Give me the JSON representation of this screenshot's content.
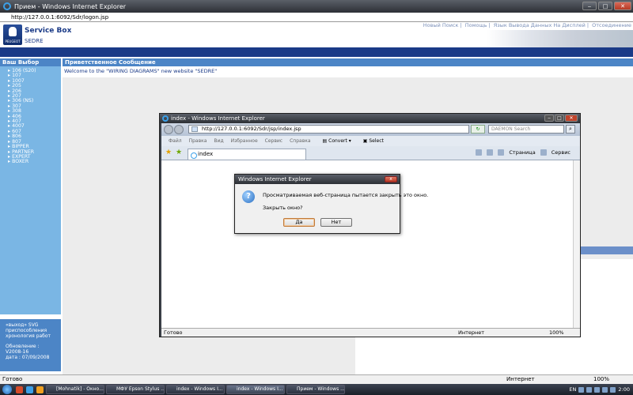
{
  "browser": {
    "title": "Прием - Windows Internet Explorer",
    "url": "http://127.0.0.1:6092/Sdr/logon.jsp",
    "status": "Готово",
    "zone": "Интернет",
    "zoom": "100%"
  },
  "header": {
    "brand": "Service Box",
    "subbrand": "SEDRE",
    "logo_text": "PEUGEOT",
    "links": [
      "Новый Поиск",
      "Помощь",
      "Язык Вывода Данных На Дисплей",
      "Отсоединение"
    ]
  },
  "left": {
    "title": "Ваш Выбор",
    "items": [
      "106 (S20)",
      "107",
      "1007",
      "205",
      "206",
      "207",
      "306 (NS)",
      "307",
      "308",
      "406",
      "407",
      "4007",
      "607",
      "806",
      "807",
      "BIPPER",
      "PARTNER",
      "EXPERT",
      "BOXER"
    ],
    "footer": {
      "line1": "«выход» SVG",
      "line2": "приспособления",
      "line3": "хронология работ",
      "line4": "Обновление : V2008-16",
      "line5": "дата : 07/09/2008"
    }
  },
  "welcome": {
    "title": "Приветственное Сообщение",
    "text": "Welcome to the \"WIRING DIAGRAMS\" new website \"SEDRE\""
  },
  "popup": {
    "title": "index - Windows Internet Explorer",
    "url": "http://127.0.0.1:6092/Sdr/jsp/index.jsp",
    "search_placeholder": "DAEMON Search",
    "menu": [
      "Файл",
      "Правка",
      "Вид",
      "Избранное",
      "Сервис",
      "Справка"
    ],
    "convert": "Convert",
    "select": "Select",
    "tab": "index",
    "page_label": "Страница",
    "service_label": "Сервис",
    "status": "Готово",
    "zone": "Интернет",
    "zoom": "100%"
  },
  "dialog": {
    "title": "Windows Internet Explorer",
    "message": "Просматриваемая веб-страница пытается закрыть это окно.",
    "question": "Закрыть окно?",
    "yes": "Да",
    "no": "Нет"
  },
  "taskbar": {
    "tasks": [
      "[Mohnatik] - Окно...",
      "МФУ Epson Stylus ...",
      "index - Windows I...",
      "index - Windows I...",
      "Прием - Windows ..."
    ],
    "lang": "EN",
    "clock": "2:00"
  }
}
